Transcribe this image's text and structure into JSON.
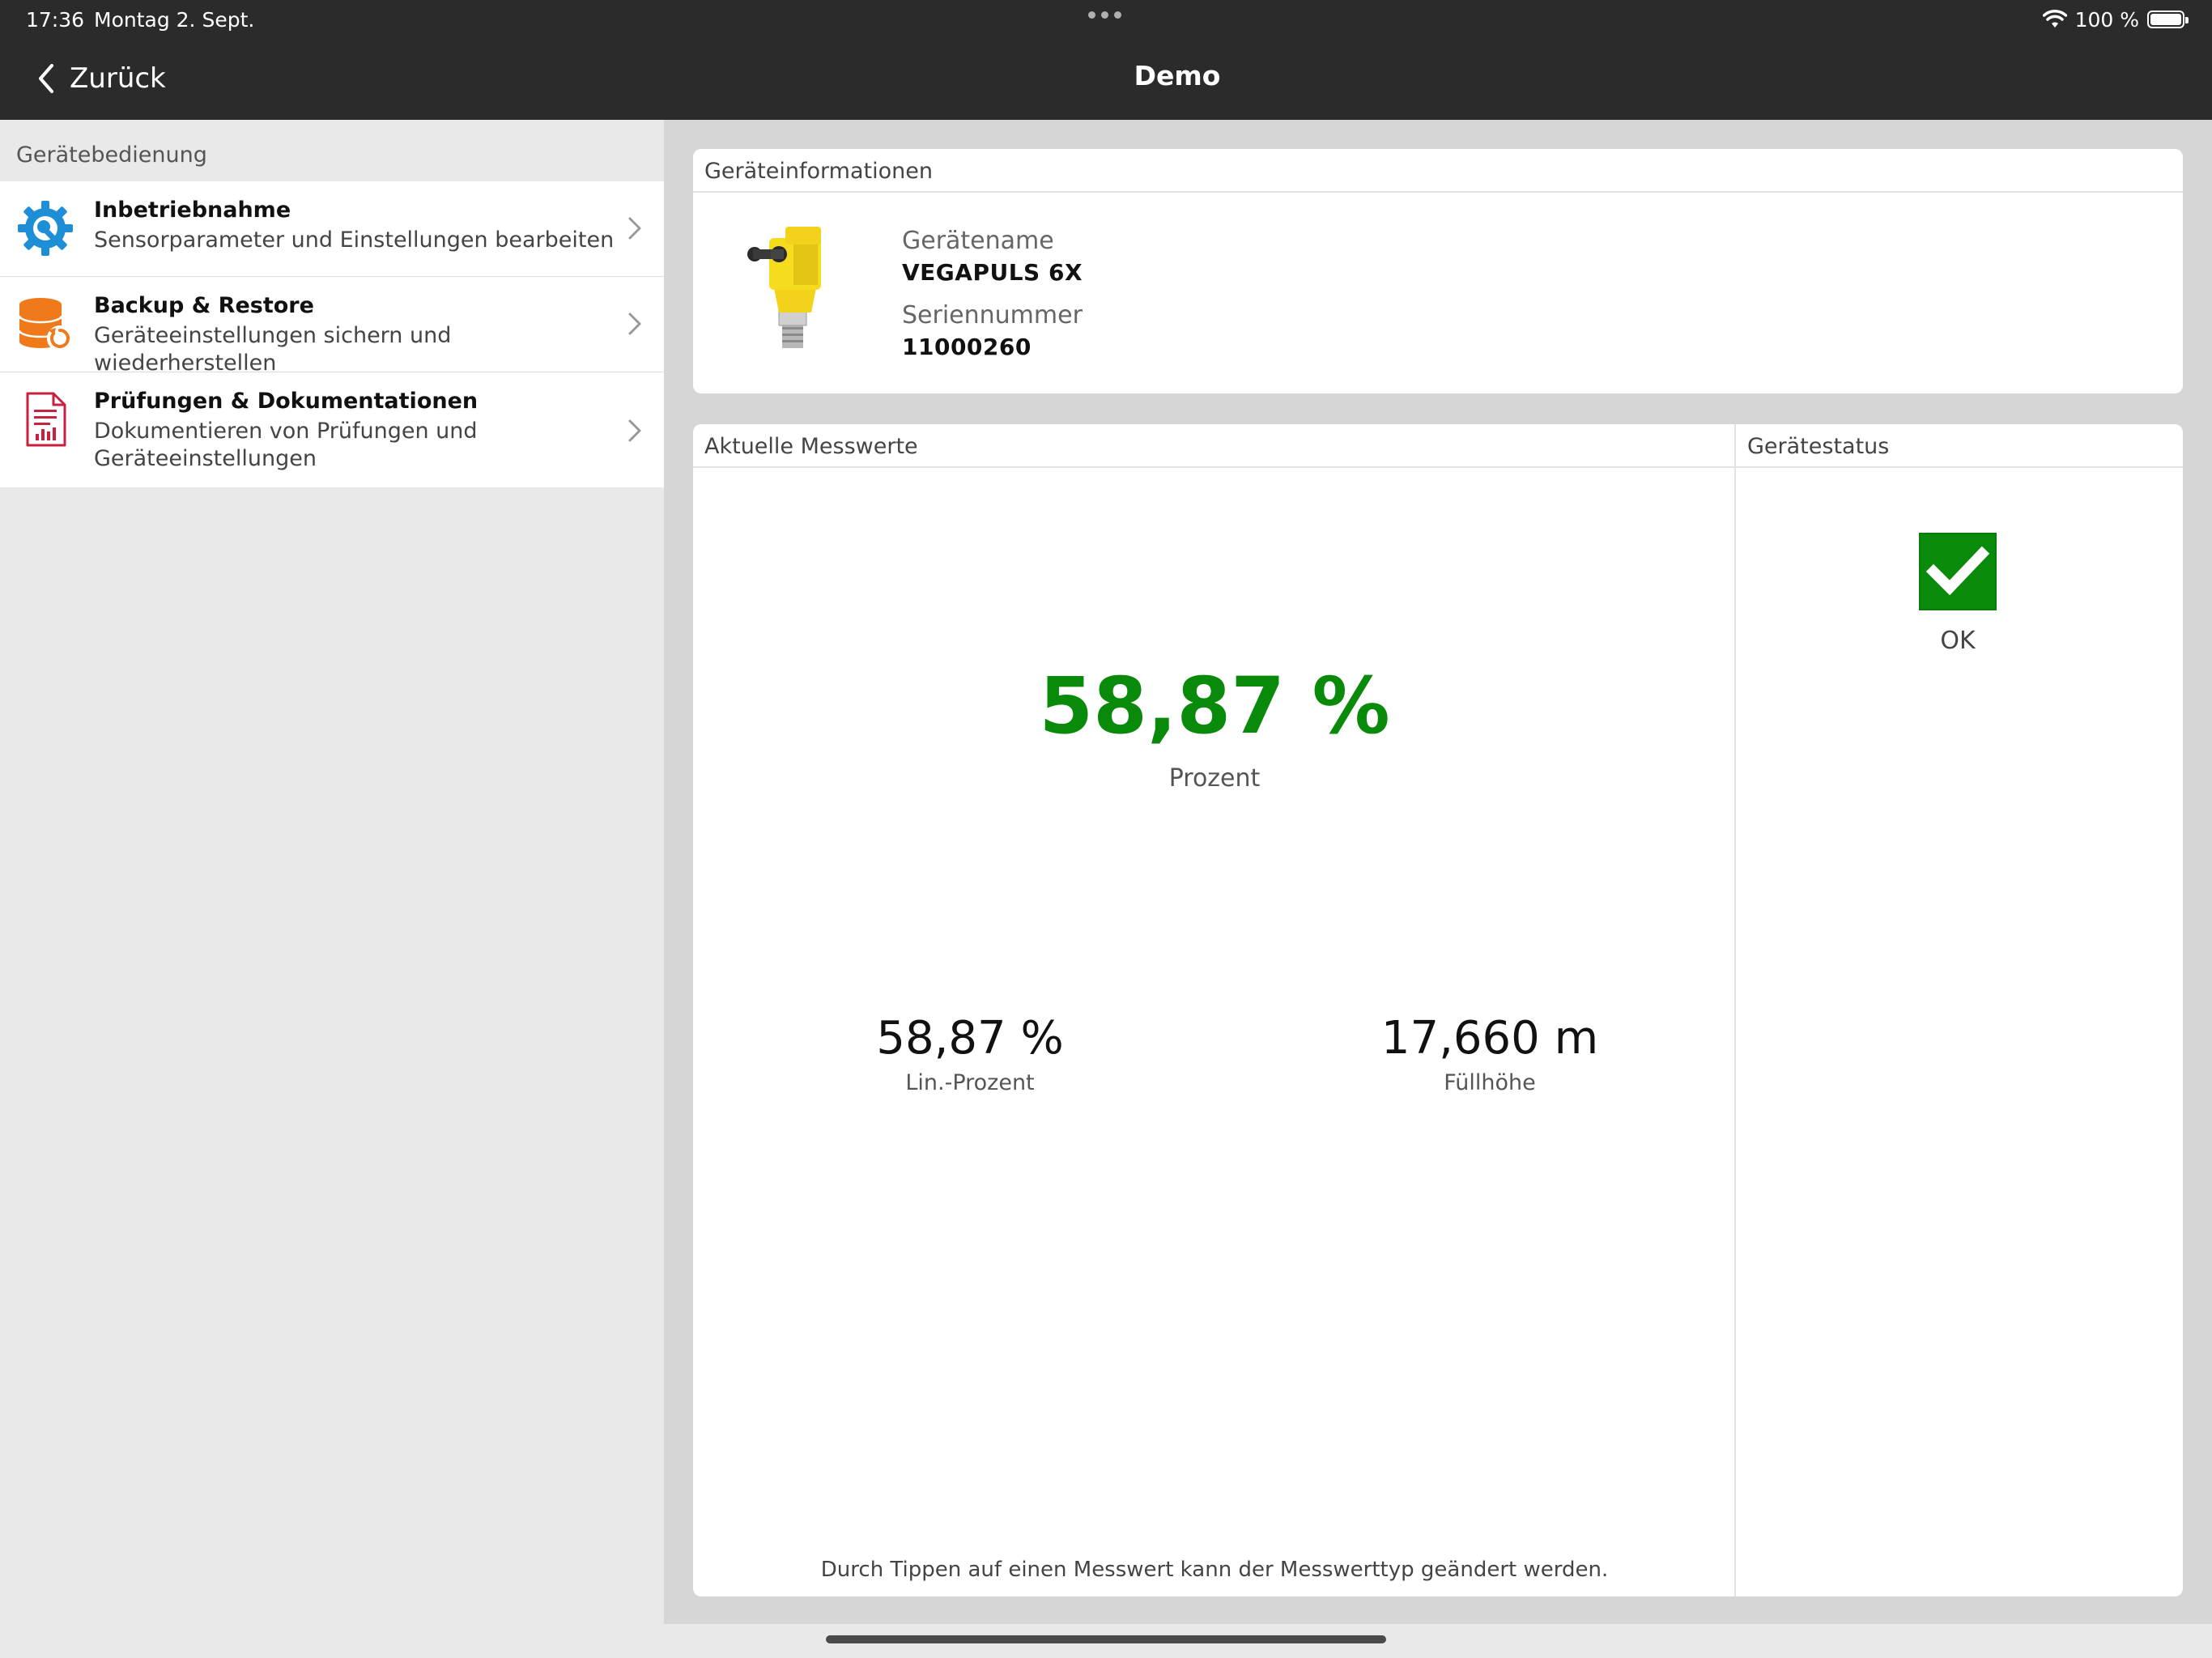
{
  "status_bar": {
    "time": "17:36",
    "date": "Montag 2. Sept.",
    "battery": "100 %"
  },
  "nav": {
    "back_label": "Zurück",
    "title": "Demo"
  },
  "sidebar": {
    "section_title": "Gerätebedienung",
    "items": [
      {
        "title": "Inbetriebnahme",
        "description": "Sensorparameter und Einstellungen bearbeiten",
        "icon": "gear-wrench-icon"
      },
      {
        "title": "Backup & Restore",
        "description": "Geräteeinstellungen sichern und wiederherstellen",
        "icon": "database-restore-icon"
      },
      {
        "title": "Prüfungen & Dokumentationen",
        "description": "Dokumentieren von Prüfungen und Geräteeinstellungen",
        "icon": "report-document-icon"
      }
    ]
  },
  "device_info": {
    "header": "Geräteinformationen",
    "name_label": "Gerätename",
    "name_value": "VEGAPULS 6X",
    "serial_label": "Seriennummer",
    "serial_value": "11000260"
  },
  "measurements": {
    "header": "Aktuelle Messwerte",
    "primary_value": "58,87 %",
    "primary_label": "Prozent",
    "secondary": [
      {
        "value": "58,87 %",
        "label": "Lin.-Prozent"
      },
      {
        "value": "17,660 m",
        "label": "Füllhöhe"
      }
    ],
    "hint": "Durch Tippen auf einen Messwert kann der Messwerttyp geändert werden."
  },
  "device_status": {
    "header": "Gerätestatus",
    "status_label": "OK"
  },
  "colors": {
    "accent_green": "#0a8a0a",
    "topbar": "#2b2b2b"
  }
}
